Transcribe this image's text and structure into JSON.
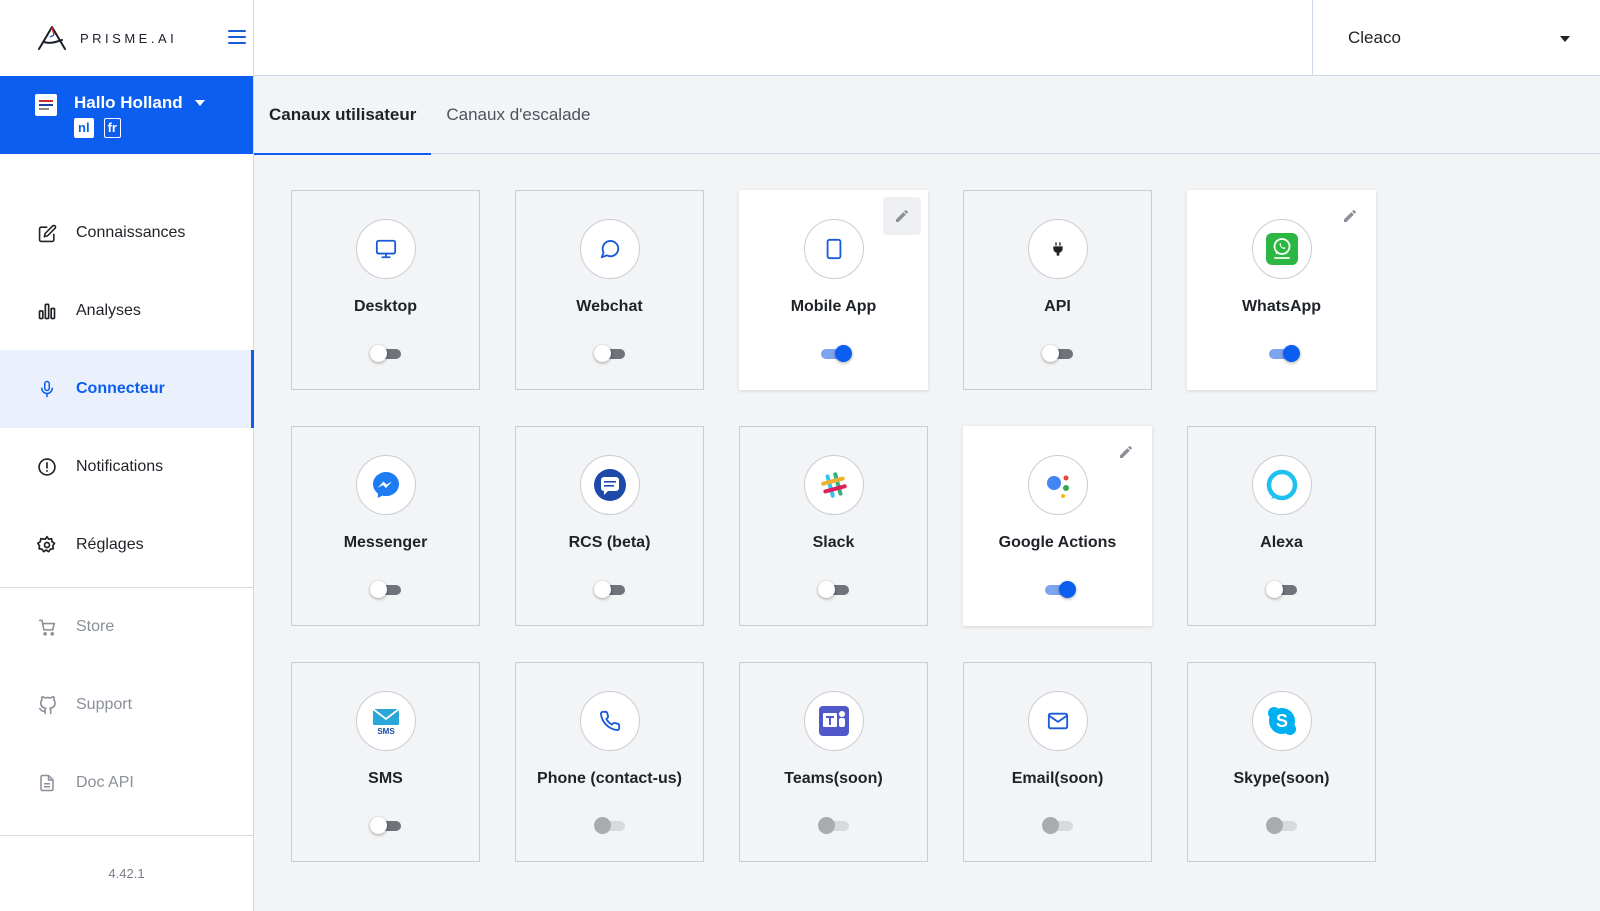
{
  "app": {
    "logo_text": "PRISME.AI",
    "version": "4.42.1"
  },
  "workspace": {
    "name": "Hallo Holland",
    "languages": [
      "nl",
      "fr"
    ]
  },
  "org_selector": {
    "value": "Cleaco"
  },
  "nav": {
    "primary": [
      {
        "label": "Connaissances",
        "icon": "edit-icon"
      },
      {
        "label": "Analyses",
        "icon": "bar-chart-icon"
      },
      {
        "label": "Connecteur",
        "icon": "microphone-icon",
        "active": true
      },
      {
        "label": "Notifications",
        "icon": "alert-circle-icon"
      },
      {
        "label": "Réglages",
        "icon": "gear-icon"
      }
    ],
    "secondary": [
      {
        "label": "Store",
        "icon": "cart-icon"
      },
      {
        "label": "Support",
        "icon": "github-icon"
      },
      {
        "label": "Doc API",
        "icon": "document-icon"
      }
    ]
  },
  "tabs": [
    {
      "label": "Canaux utilisateur",
      "active": true
    },
    {
      "label": "Canaux d'escalade",
      "active": false
    }
  ],
  "channels": [
    {
      "name": "Desktop",
      "icon": "monitor-icon",
      "enabled": false
    },
    {
      "name": "Webchat",
      "icon": "chat-bubble-icon",
      "enabled": false
    },
    {
      "name": "Mobile App",
      "icon": "tablet-icon",
      "enabled": true,
      "editable": true
    },
    {
      "name": "API",
      "icon": "plug-icon",
      "enabled": false
    },
    {
      "name": "WhatsApp",
      "icon": "whatsapp-icon",
      "enabled": true,
      "editable": true
    },
    {
      "name": "Messenger",
      "icon": "messenger-icon",
      "enabled": false
    },
    {
      "name": "RCS (beta)",
      "icon": "rcs-icon",
      "enabled": false
    },
    {
      "name": "Slack",
      "icon": "slack-icon",
      "enabled": false
    },
    {
      "name": "Google Actions",
      "icon": "google-assistant-icon",
      "enabled": true,
      "editable": true
    },
    {
      "name": "Alexa",
      "icon": "alexa-icon",
      "enabled": false
    },
    {
      "name": "SMS",
      "icon": "sms-icon",
      "enabled": false
    },
    {
      "name": "Phone (contact-us)",
      "icon": "phone-icon",
      "enabled": false,
      "disabled": true
    },
    {
      "name": "Teams(soon)",
      "icon": "teams-icon",
      "enabled": false,
      "disabled": true
    },
    {
      "name": "Email(soon)",
      "icon": "mail-icon",
      "enabled": false,
      "disabled": true
    },
    {
      "name": "Skype(soon)",
      "icon": "skype-icon",
      "enabled": false,
      "disabled": true
    }
  ],
  "colors": {
    "primary": "#0c5ef0",
    "background": "#f3f4f6",
    "toggle_off": "#6f737a"
  }
}
